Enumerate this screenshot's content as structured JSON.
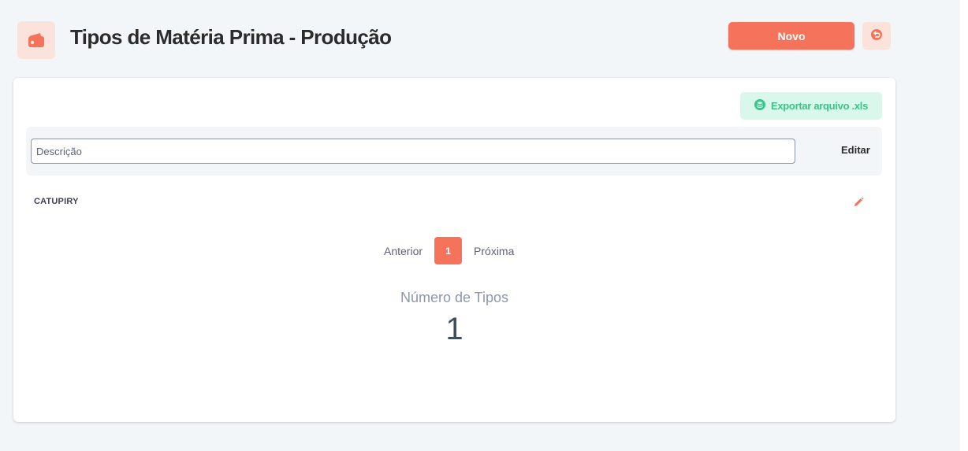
{
  "header": {
    "title": "Tipos de Matéria Prima - Produção",
    "icon": "wallet-icon",
    "new_button_label": "Novo",
    "back_icon": "undo-icon"
  },
  "toolbar": {
    "export_label": "Exportar arquivo .xls",
    "export_icon": "database-icon"
  },
  "filter": {
    "description_placeholder": "Descrição",
    "description_value": "",
    "edit_column_label": "Editar"
  },
  "rows": [
    {
      "description": "CATUPIRY",
      "edit_icon": "pencil-icon"
    }
  ],
  "pagination": {
    "previous_label": "Anterior",
    "current_page": "1",
    "next_label": "Próxima"
  },
  "stats": {
    "label": "Número de Tipos",
    "value": "1"
  },
  "colors": {
    "accent": "#f5735a",
    "accent_light": "#fbe3dc",
    "success": "#3cc38b",
    "success_light": "#d9f7ea",
    "background": "#f3f6f9"
  }
}
